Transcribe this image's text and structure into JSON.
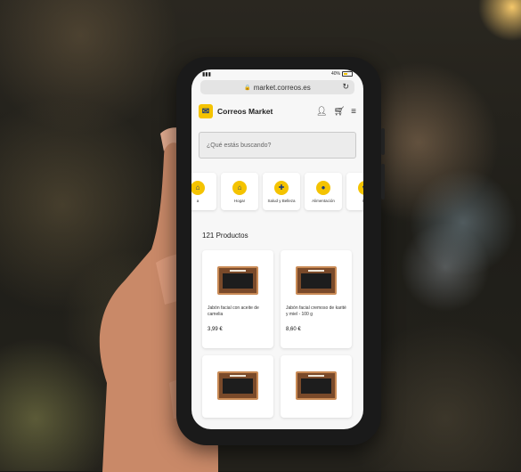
{
  "browser": {
    "url": "market.correos.es",
    "battery_text": "40%"
  },
  "header": {
    "brand": "Correos Market",
    "icons": [
      "user-icon",
      "cart-icon",
      "menu-icon"
    ]
  },
  "search": {
    "placeholder": "¿Qué estás buscando?"
  },
  "categories": [
    {
      "label": "a"
    },
    {
      "label": "Hogar"
    },
    {
      "label": "Salud y Belleza"
    },
    {
      "label": "Alimentación"
    },
    {
      "label": "Be"
    }
  ],
  "results": {
    "count_label": "121 Productos"
  },
  "products": [
    {
      "name": "Jabón facial con aceite de camelia",
      "price": "3,99 €"
    },
    {
      "name": "Jabón facial cremoso de karité y miel - 100 g",
      "price": "8,60 €"
    }
  ],
  "colors": {
    "brand_yellow": "#f4c300",
    "brand_blue": "#1b3a7a"
  }
}
